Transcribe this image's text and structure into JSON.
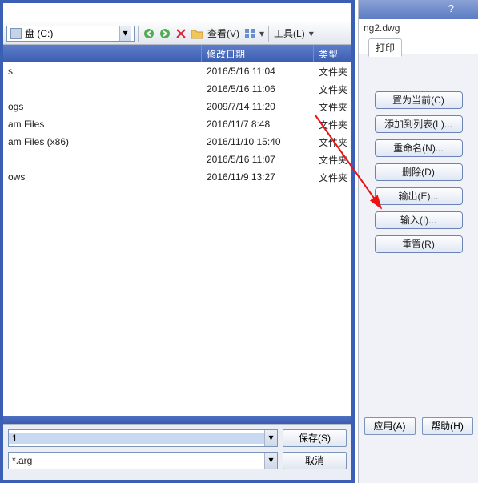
{
  "dialog": {
    "path_label": "盘 (C:)",
    "dd_glyph": "▾",
    "toolbar": {
      "view_label": "查看",
      "tools_label": "工具"
    },
    "columns": {
      "name": "",
      "date": "修改日期",
      "type": "类型"
    },
    "rows": [
      {
        "name": "s",
        "date": "2016/5/16 11:04",
        "type": "文件夹"
      },
      {
        "name": "",
        "date": "2016/5/16 11:06",
        "type": "文件夹"
      },
      {
        "name": "ogs",
        "date": "2009/7/14 11:20",
        "type": "文件夹"
      },
      {
        "name": "am Files",
        "date": "2016/11/7 8:48",
        "type": "文件夹"
      },
      {
        "name": "am Files (x86)",
        "date": "2016/11/10 15:40",
        "type": "文件夹"
      },
      {
        "name": "",
        "date": "2016/5/16 11:07",
        "type": "文件夹"
      },
      {
        "name": "ows",
        "date": "2016/11/9 13:27",
        "type": "文件夹"
      }
    ],
    "bottom": {
      "filename_value": "1",
      "filter_value": "*.arg",
      "save": "保存(S)",
      "cancel": "取消"
    }
  },
  "right": {
    "tab_filename": "ng2.dwg",
    "tab_label": "打印",
    "help_glyph": "?",
    "buttons": {
      "set_current": "置为当前(C)",
      "add_to_list": "添加到列表(L)...",
      "rename": "重命名(N)...",
      "delete": "删除(D)",
      "export": "输出(E)...",
      "import": "输入(I)...",
      "reset": "重置(R)"
    },
    "bottom": {
      "apply": "应用(A)",
      "help": "帮助(H)"
    }
  },
  "toolbar_accents": {
    "V": "V",
    "L": "L"
  }
}
